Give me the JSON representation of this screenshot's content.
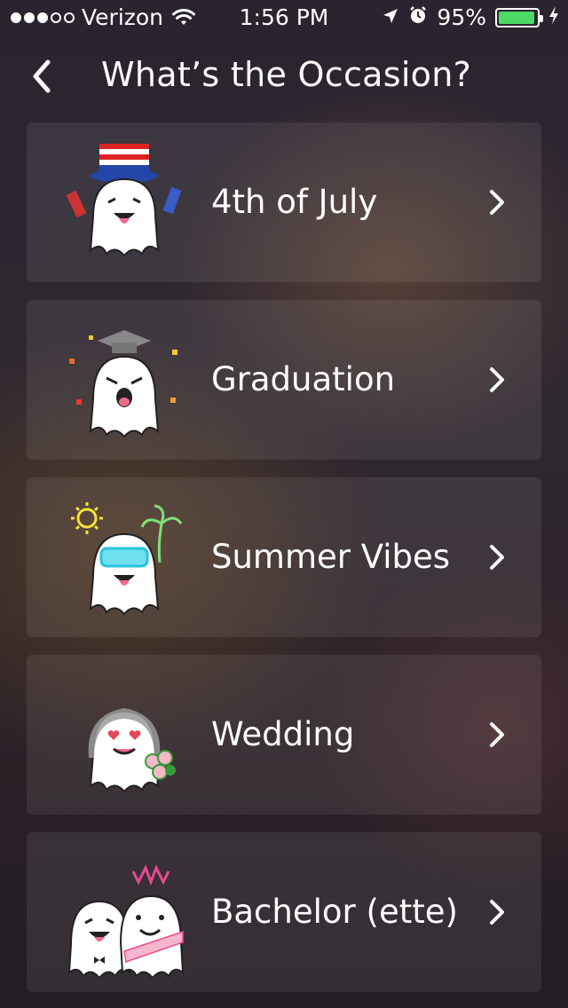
{
  "status_bar": {
    "carrier": "Verizon",
    "time": "1:56 PM",
    "battery": "95%",
    "battery_level": 0.95,
    "battery_color": "#4cd964"
  },
  "header": {
    "title": "What’s the Occasion?",
    "back_icon": "chevron-left-icon"
  },
  "occasions": [
    {
      "label": "4th of July",
      "icon": "ghost-uncle-sam-icon"
    },
    {
      "label": "Graduation",
      "icon": "ghost-graduation-cap-icon"
    },
    {
      "label": "Summer Vibes",
      "icon": "ghost-sunglasses-palm-icon"
    },
    {
      "label": "Wedding",
      "icon": "ghost-bride-bouquet-icon"
    },
    {
      "label": "Bachelor (ette)",
      "icon": "ghost-couple-tiara-icon"
    }
  ]
}
